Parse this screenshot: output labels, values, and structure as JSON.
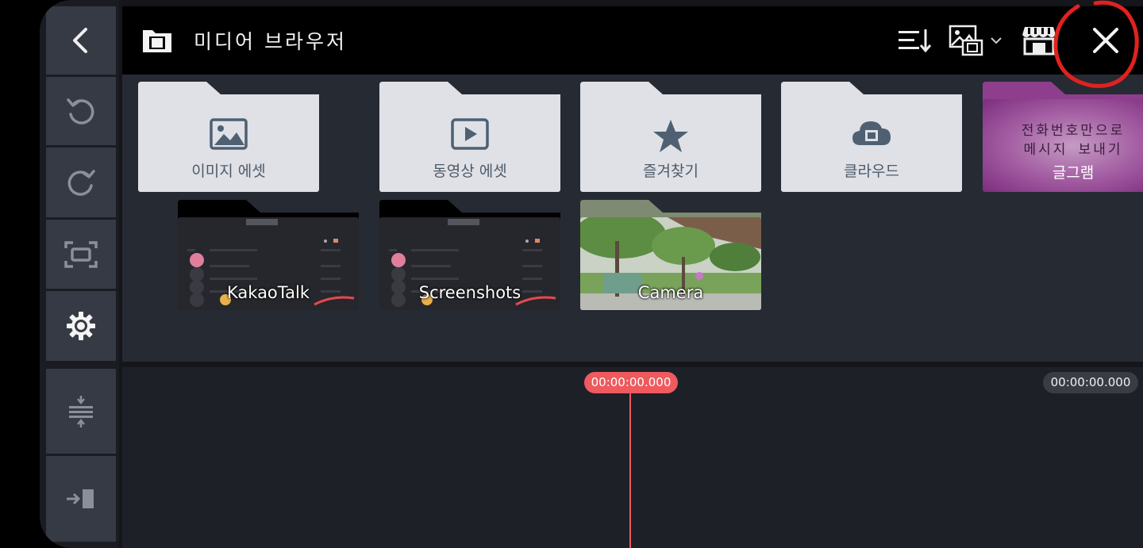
{
  "header": {
    "title": "미디어 브라우저",
    "icons": [
      "film-folder-icon",
      "sort-icon",
      "media-filter-icon",
      "chevron-down-icon",
      "store-icon",
      "close-icon"
    ]
  },
  "rail": {
    "icons": [
      "back-icon",
      "undo-icon",
      "redo-icon",
      "fullscreen-icon",
      "settings-icon",
      "layer-adjust-icon",
      "export-icon"
    ]
  },
  "folders": [
    {
      "label": "이미지 에셋",
      "icon": "image-icon"
    },
    {
      "label": "동영상 에셋",
      "icon": "video-icon"
    },
    {
      "label": "즐겨찾기",
      "icon": "star-icon"
    },
    {
      "label": "클라우드",
      "icon": "cloud-icon"
    },
    {
      "label": "글그램",
      "poster_lines": [
        "전화번호만으로",
        "메시지 보내기"
      ]
    }
  ],
  "albums": [
    {
      "label": "KakaoTalk"
    },
    {
      "label": "Screenshots"
    },
    {
      "label": "Camera"
    }
  ],
  "timeline": {
    "playhead_time": "00:00:00.000",
    "end_time": "00:00:00.000"
  },
  "colors": {
    "accent": "#ee5a5e",
    "panel": "#262a33",
    "folder": "#dfe1e6",
    "icon": "#4e6072"
  }
}
